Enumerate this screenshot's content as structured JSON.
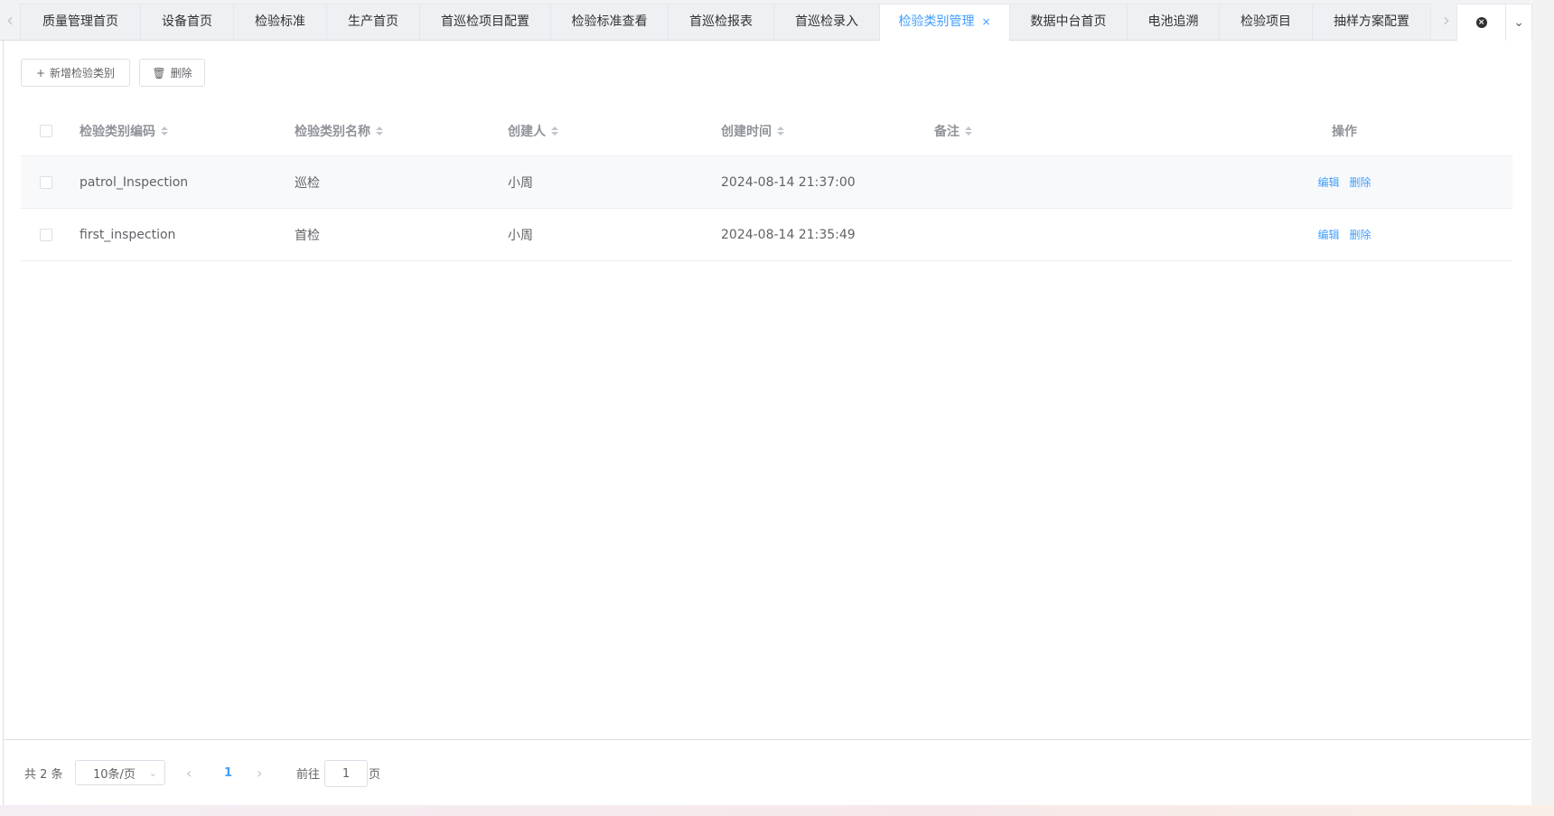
{
  "tabs": [
    {
      "label": "质量管理首页"
    },
    {
      "label": "设备首页"
    },
    {
      "label": "检验标准"
    },
    {
      "label": "生产首页"
    },
    {
      "label": "首巡检项目配置"
    },
    {
      "label": "检验标准查看"
    },
    {
      "label": "首巡检报表"
    },
    {
      "label": "首巡检录入"
    },
    {
      "label": "检验类别管理",
      "close": "×"
    },
    {
      "label": "数据中台首页"
    },
    {
      "label": "电池追溯"
    },
    {
      "label": "检验项目"
    },
    {
      "label": "抽样方案配置"
    }
  ],
  "tab_nav": {
    "prev": "‹",
    "next": "›",
    "close_all": "×",
    "dropdown": "⌄"
  },
  "toolbar": {
    "add_icon": "+",
    "add_label": "新增检验类别",
    "delete_icon": "🗑",
    "delete_label": "删除"
  },
  "table": {
    "columns": {
      "code": "检验类别编码",
      "name": "检验类别名称",
      "creator": "创建人",
      "created_at": "创建时间",
      "remark": "备注",
      "ops": "操作"
    },
    "rows": [
      {
        "code": "patrol_Inspection",
        "name": "巡检",
        "creator": "小周",
        "created_at": "2024-08-14 21:37:00",
        "remark": "",
        "edit": "编辑",
        "delete": "删除"
      },
      {
        "code": "first_inspection",
        "name": "首检",
        "creator": "小周",
        "created_at": "2024-08-14 21:35:49",
        "remark": "",
        "edit": "编辑",
        "delete": "删除"
      }
    ]
  },
  "pagination": {
    "total": "共 2 条",
    "page_size": "10条/页",
    "prev": "‹",
    "current": "1",
    "next": "›",
    "goto_label": "前往",
    "goto_value": "1",
    "page_unit": "页"
  },
  "colors": {
    "accent": "#409eff",
    "header_text": "#909399",
    "border": "#dcdfe6"
  }
}
